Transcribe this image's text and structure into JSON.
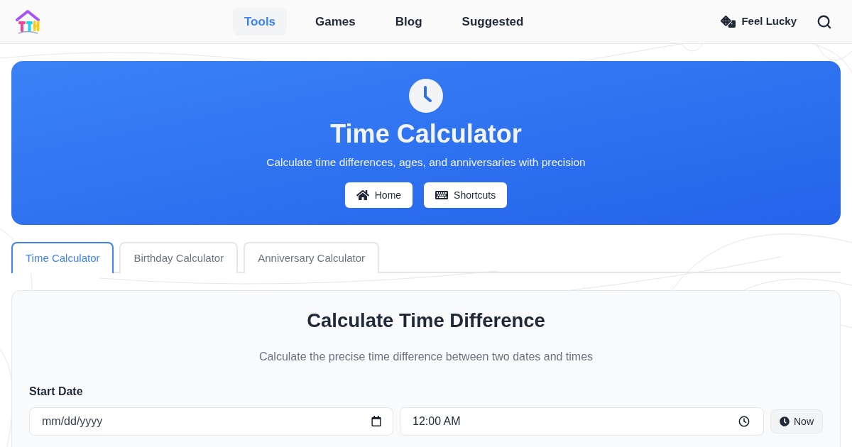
{
  "header": {
    "nav": [
      {
        "label": "Tools",
        "selected": true
      },
      {
        "label": "Games",
        "selected": false
      },
      {
        "label": "Blog",
        "selected": false
      },
      {
        "label": "Suggested",
        "selected": false
      }
    ],
    "lucky_button": "Feel Lucky"
  },
  "hero": {
    "title": "Time Calculator",
    "subtitle": "Calculate time differences, ages, and anniversaries with precision",
    "buttons": [
      {
        "label": "Home",
        "kind": "home"
      },
      {
        "label": "Shortcuts",
        "kind": "keyboard"
      }
    ]
  },
  "tabs": [
    {
      "label": "Time Calculator",
      "selected": true
    },
    {
      "label": "Birthday Calculator",
      "selected": false
    },
    {
      "label": "Anniversary Calculator",
      "selected": false
    }
  ],
  "panel": {
    "title": "Calculate Time Difference",
    "subtitle": "Calculate the precise time difference between two dates and times",
    "start_date": {
      "label": "Start Date",
      "date_placeholder": "mm/dd/yyyy",
      "time_value": "12:00 AM",
      "now_button": "Now"
    }
  }
}
